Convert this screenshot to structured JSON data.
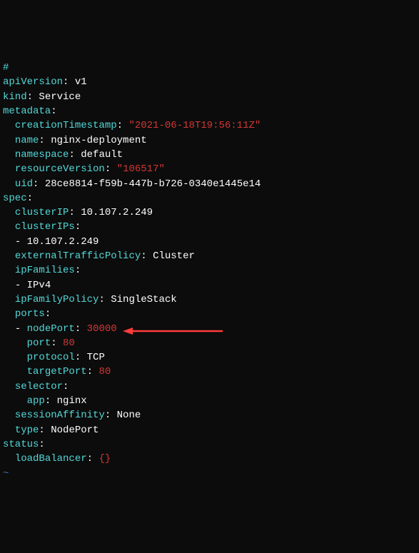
{
  "prompt": "#",
  "lines": {
    "apiVersion_k": "apiVersion",
    "apiVersion_v": "v1",
    "kind_k": "kind",
    "kind_v": "Service",
    "metadata_k": "metadata",
    "creationTimestamp_k": "creationTimestamp",
    "creationTimestamp_v": "\"2021-06-18T19:56:11Z\"",
    "name_k": "name",
    "name_v": "nginx-deployment",
    "namespace_k": "namespace",
    "namespace_v": "default",
    "resourceVersion_k": "resourceVersion",
    "resourceVersion_v": "\"106517\"",
    "uid_k": "uid",
    "uid_v": "28ce8814-f59b-447b-b726-0340e1445e14",
    "spec_k": "spec",
    "clusterIP_k": "clusterIP",
    "clusterIP_v": "10.107.2.249",
    "clusterIPs_k": "clusterIPs",
    "clusterIPs_item": "10.107.2.249",
    "externalTrafficPolicy_k": "externalTrafficPolicy",
    "externalTrafficPolicy_v": "Cluster",
    "ipFamilies_k": "ipFamilies",
    "ipFamilies_item": "IPv4",
    "ipFamilyPolicy_k": "ipFamilyPolicy",
    "ipFamilyPolicy_v": "SingleStack",
    "ports_k": "ports",
    "nodePort_k": "nodePort",
    "nodePort_v": "30000",
    "port_k": "port",
    "port_v": "80",
    "protocol_k": "protocol",
    "protocol_v": "TCP",
    "targetPort_k": "targetPort",
    "targetPort_v": "80",
    "selector_k": "selector",
    "app_k": "app",
    "app_v": "nginx",
    "sessionAffinity_k": "sessionAffinity",
    "sessionAffinity_v": "None",
    "type_k": "type",
    "type_v": "NodePort",
    "status_k": "status",
    "loadBalancer_k": "loadBalancer",
    "loadBalancer_v": "{}",
    "tilde": "~"
  }
}
